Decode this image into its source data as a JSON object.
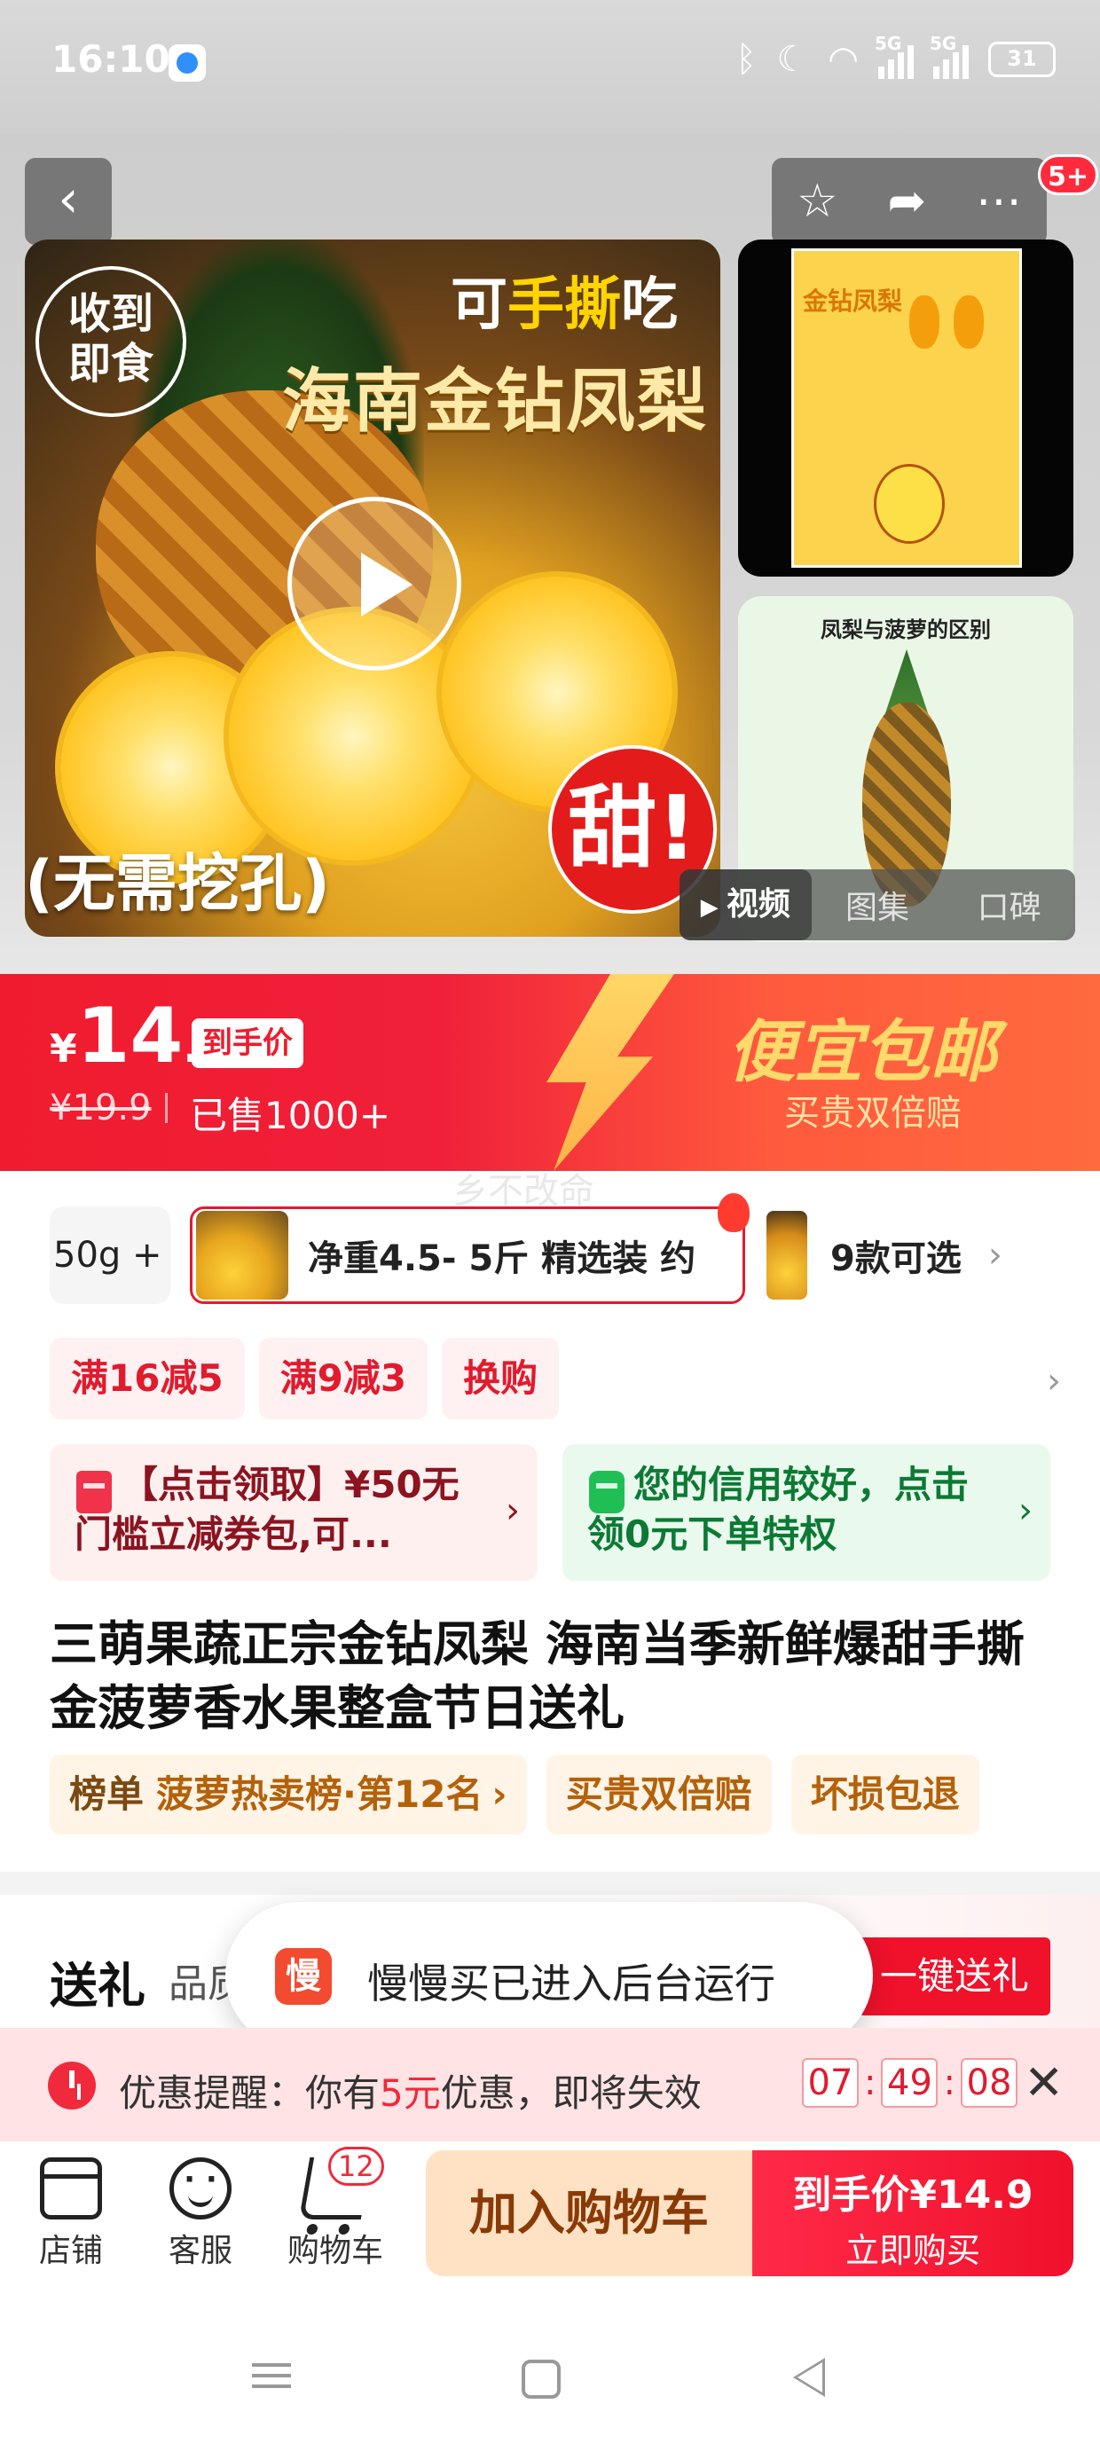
{
  "status_bar": {
    "time": "16:10",
    "network_1": "5G",
    "network_2": "5G",
    "battery": "31"
  },
  "gallery": {
    "main_image_title_line1_a": "可",
    "main_image_title_line1_b": "手撕",
    "main_image_title_line1_c": "吃",
    "main_image_title_line2": "海南金钻凤梨",
    "stamp_text_line1": "收到",
    "stamp_text_line2": "即食",
    "sweet_label": "甜!",
    "note": "(无需挖孔)",
    "thumb1_title": "金钻凤梨",
    "thumb2_title": "凤梨与菠萝的区别",
    "share_badge": "5+",
    "tabs": [
      {
        "label": "视频",
        "active": true
      },
      {
        "label": "图集",
        "active": false
      },
      {
        "label": "口碑",
        "active": false
      }
    ]
  },
  "price": {
    "currency": "¥",
    "integer": "14",
    "decimal": ".9",
    "tag": "到手价",
    "original": "¥19.9",
    "sold": "已售1000+",
    "slogan": "便宜包邮",
    "slogan_sub": "买贵双倍赔"
  },
  "watermark": "乡不改命",
  "specs": {
    "first_label": "50g +",
    "selected_label": "净重4.5- 5斤 精选装 约",
    "more_label": "9款可选"
  },
  "promotions": [
    "满16减5",
    "满9减3",
    "换购"
  ],
  "coupons": {
    "left": "【点击领取】¥50无门槛立减券包,可...",
    "right": "您的信用较好，点击领0元下单特权"
  },
  "product_title": "三萌果蔬正宗金钻凤梨 海南当季新鲜爆甜手撕金菠萝香水果整盒节日送礼",
  "badges": {
    "rank_key": "榜单",
    "rank_value": "菠萝热卖榜·第12名",
    "guarantee1": "买贵双倍赔",
    "guarantee2": "坏损包退"
  },
  "gift": {
    "title": "送礼",
    "subtitle": "品质",
    "button": "一键送礼"
  },
  "toast": {
    "logo_char": "慢",
    "message": "慢慢买已进入后台运行"
  },
  "reminder": {
    "prefix": "优惠提醒：你有",
    "amount": "5元",
    "suffix": "优惠，即将失效",
    "hours": "07",
    "minutes": "49",
    "seconds": "08"
  },
  "action_bar": {
    "store": "店铺",
    "service": "客服",
    "cart": "购物车",
    "cart_count": "12",
    "add_to_cart": "加入购物车",
    "buy_price": "到手价¥14.9",
    "buy_now": "立即购买"
  },
  "colors": {
    "brand_red": "#f0112b",
    "price_banner": "#f01b2e",
    "cart_button": "#ffe2c4",
    "reminder_bg": "#ffe3e5"
  }
}
